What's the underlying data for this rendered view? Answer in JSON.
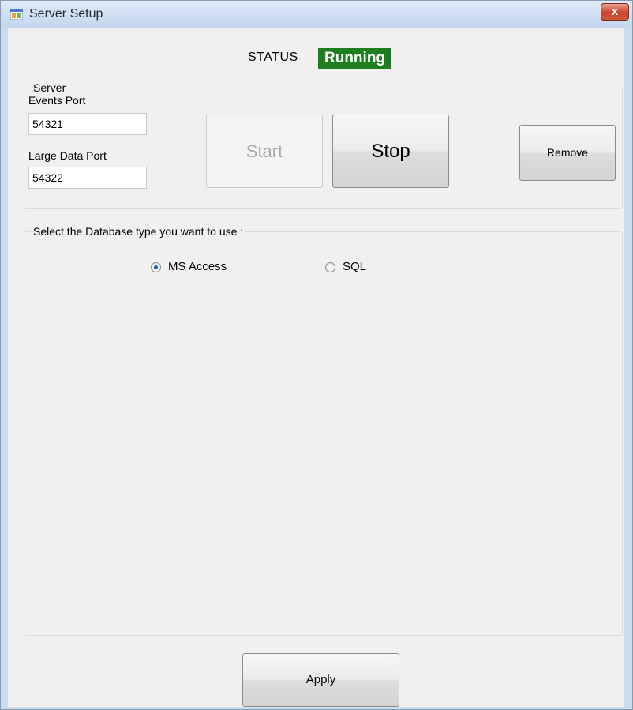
{
  "window": {
    "title": "Server Setup",
    "close_symbol": "x",
    "app_icon": "window-app-icon"
  },
  "status": {
    "label": "STATUS",
    "value": "Running",
    "color": "#1e7d1e"
  },
  "server": {
    "group_label": "Server",
    "events_port_label": "Events Port",
    "events_port_value": "54321",
    "large_data_port_label": "Large Data Port",
    "large_data_port_value": "54322"
  },
  "buttons": {
    "start": "Start",
    "stop": "Stop",
    "remove": "Remove",
    "apply": "Apply"
  },
  "database": {
    "group_label": "Select the Database type you want to use :",
    "options": [
      {
        "label": "MS Access",
        "selected": true
      },
      {
        "label": "SQL",
        "selected": false
      }
    ]
  },
  "colors": {
    "status_running": "#1e7d1e",
    "close_button": "#c8432b",
    "titlebar": "#c9dcf0"
  }
}
